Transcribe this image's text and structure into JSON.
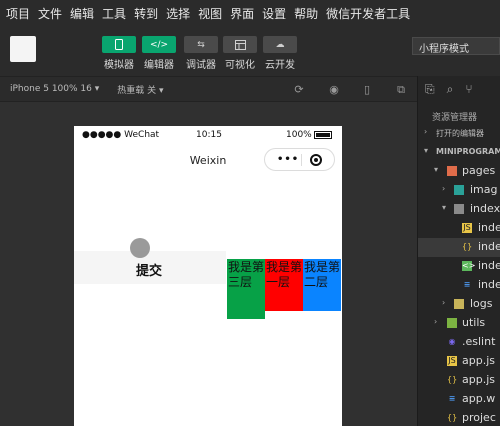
{
  "menubar": {
    "items": [
      "项目",
      "文件",
      "编辑",
      "工具",
      "转到",
      "选择",
      "视图",
      "界面",
      "设置",
      "帮助",
      "微信开发者工具"
    ]
  },
  "toolbar": {
    "buttons": [
      {
        "label": "模拟器",
        "icon": "phone-icon",
        "color": "#09a56f"
      },
      {
        "label": "编辑器",
        "icon": "code-icon",
        "color": "#09a56f"
      },
      {
        "label": "调试器",
        "icon": "debug-icon",
        "color": "#4a4a4a"
      },
      {
        "label": "可视化",
        "icon": "layout-icon",
        "color": "#4a4a4a"
      },
      {
        "label": "云开发",
        "icon": "cloud-icon",
        "color": "#4a4a4a"
      }
    ],
    "mode": "小程序模式"
  },
  "simbar": {
    "device": "iPhone 5 100% 16 ▾",
    "hotreload": "热重载 关 ▾"
  },
  "phone": {
    "signal": "●●●●● WeChat",
    "time": "10:15",
    "battery": "100%",
    "nav_title": "Weixin",
    "submit": "提交",
    "layers": [
      "我是第三层",
      "我是第一层",
      "我是第二层"
    ]
  },
  "explorer": {
    "title": "资源管理器",
    "open_editors": "打开的编辑器",
    "project": "MINIPROGRAM",
    "tree": [
      "pages",
      "imag",
      "index",
      "inde",
      "inde",
      "inde",
      "inde",
      "logs",
      "utils",
      ".eslint",
      "app.js",
      "app.js",
      "app.w",
      "projec"
    ]
  }
}
